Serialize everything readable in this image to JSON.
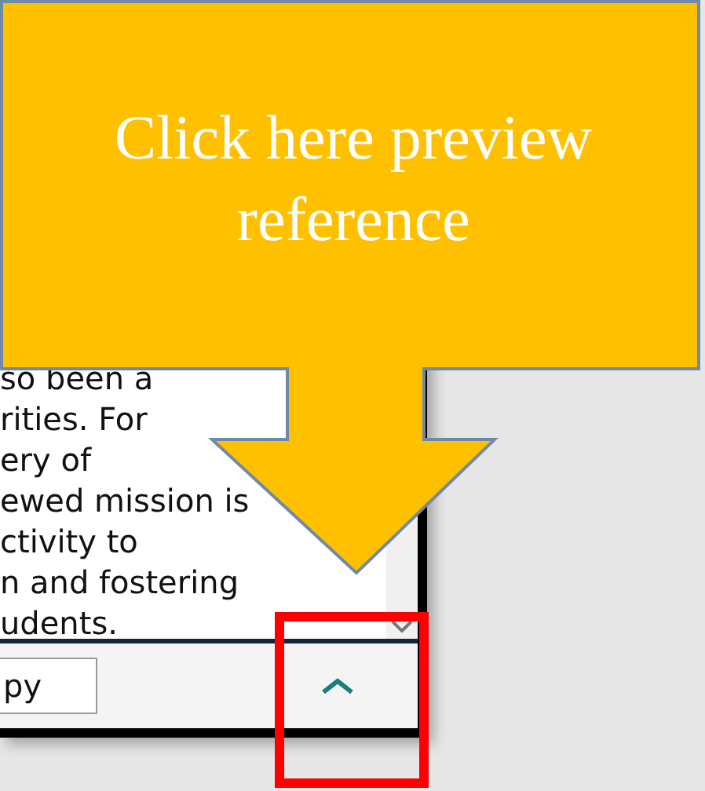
{
  "text_panel": {
    "lines": [
      "so been a",
      "rities. For",
      "ery of",
      "ewed mission is",
      "ctivity to",
      "n and fostering",
      "udents."
    ]
  },
  "footer": {
    "button": "py"
  },
  "callout": {
    "text": "Click here preview reference"
  }
}
